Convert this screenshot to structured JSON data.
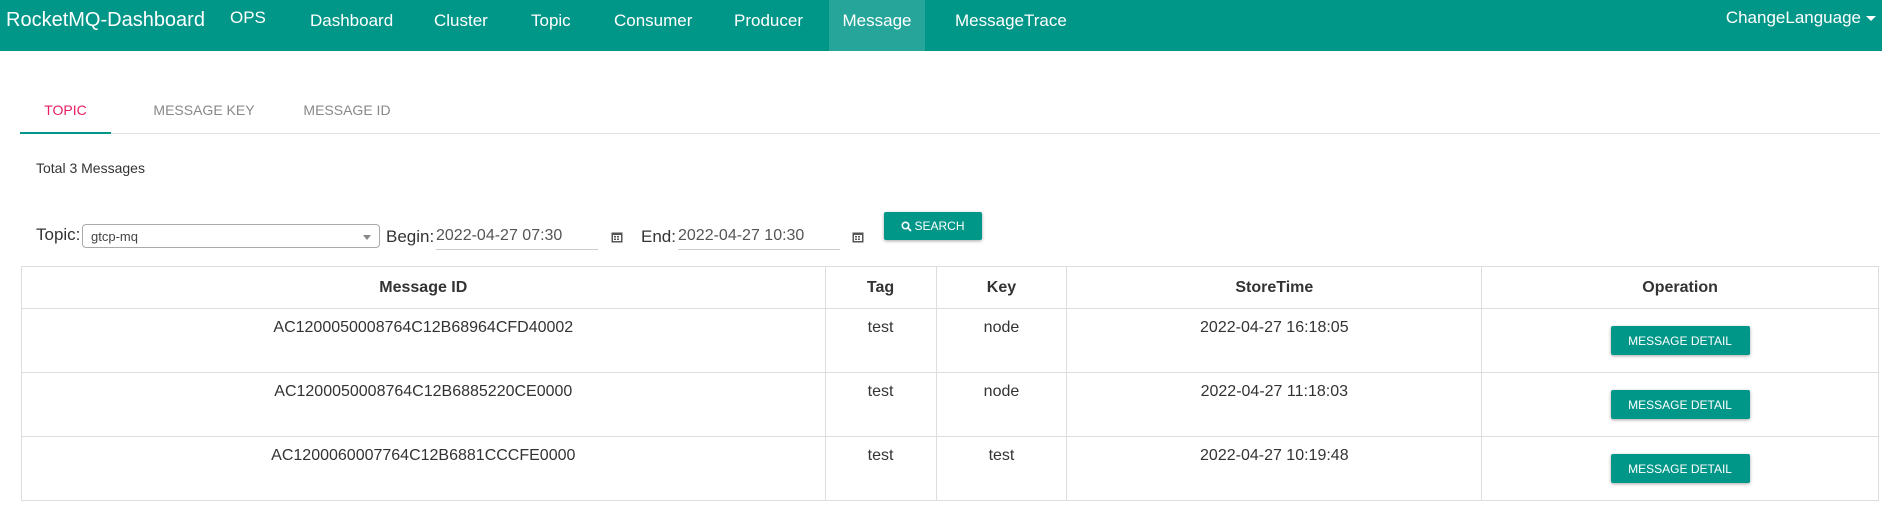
{
  "colors": {
    "brand": "#009688",
    "active_nav": "#26a69a",
    "active_tab_text": "#e91e63"
  },
  "navbar": {
    "brand": "RocketMQ-Dashboard",
    "items": [
      {
        "label": "OPS",
        "active": false
      },
      {
        "label": "Dashboard",
        "active": false
      },
      {
        "label": "Cluster",
        "active": false
      },
      {
        "label": "Topic",
        "active": false
      },
      {
        "label": "Consumer",
        "active": false
      },
      {
        "label": "Producer",
        "active": false
      },
      {
        "label": "Message",
        "active": true
      },
      {
        "label": "MessageTrace",
        "active": false
      }
    ],
    "language": "ChangeLanguage"
  },
  "tabs": [
    {
      "label": "TOPIC",
      "active": true
    },
    {
      "label": "MESSAGE KEY",
      "active": false
    },
    {
      "label": "MESSAGE ID",
      "active": false
    }
  ],
  "summary": {
    "total": "Total 3 Messages"
  },
  "filters": {
    "topic_label": "Topic:",
    "topic_value": "gtcp-mq",
    "begin_label": "Begin:",
    "begin_value": "2022-04-27 07:30",
    "end_label": "End:",
    "end_value": "2022-04-27 10:30",
    "search_label": "SEARCH",
    "search_icon": "search-icon",
    "calendar_icon": "calendar-icon"
  },
  "table": {
    "columns": [
      "Message ID",
      "Tag",
      "Key",
      "StoreTime",
      "Operation"
    ],
    "rows": [
      {
        "message_id": "AC1200050008764C12B68964CFD40002",
        "tag": "test",
        "key": "node",
        "store_time": "2022-04-27 16:18:05",
        "operation": "MESSAGE DETAIL"
      },
      {
        "message_id": "AC1200050008764C12B6885220CE0000",
        "tag": "test",
        "key": "node",
        "store_time": "2022-04-27 11:18:03",
        "operation": "MESSAGE DETAIL"
      },
      {
        "message_id": "AC1200060007764C12B6881CCCFE0000",
        "tag": "test",
        "key": "test",
        "store_time": "2022-04-27 10:19:48",
        "operation": "MESSAGE DETAIL"
      }
    ]
  }
}
